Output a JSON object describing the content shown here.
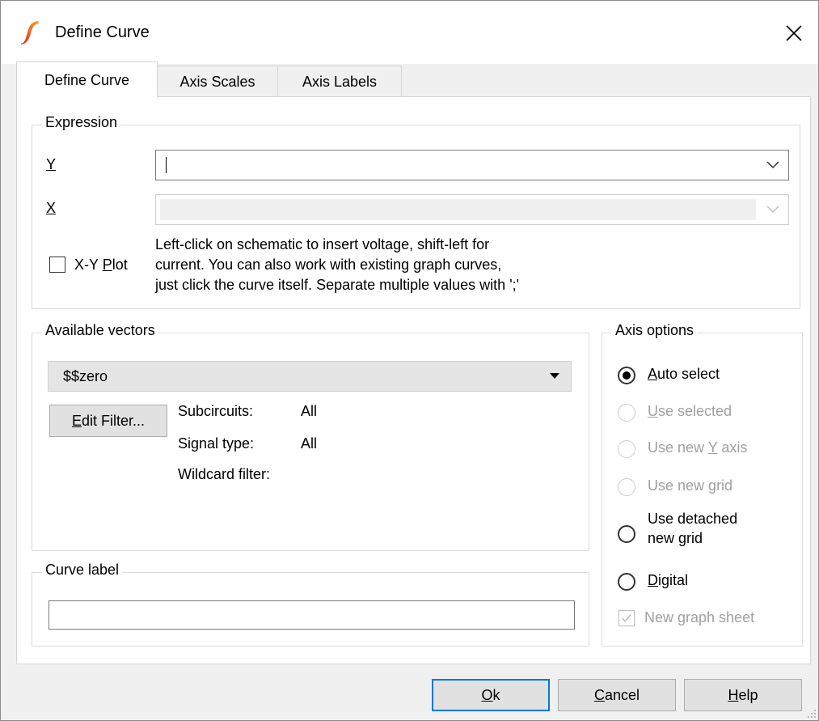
{
  "window": {
    "title": "Define Curve"
  },
  "tabs": [
    {
      "label": "Define Curve"
    },
    {
      "label": "Axis Scales"
    },
    {
      "label": "Axis Labels"
    }
  ],
  "expression": {
    "legend": "Expression",
    "y_label": "Y",
    "y_value": "",
    "x_label": "X",
    "x_value": "",
    "xy_plot_label": "X-Y ",
    "xy_plot_underlined": "P",
    "xy_plot_rest": "lot",
    "hint_line1": "Left-click on schematic to insert voltage, shift-left for",
    "hint_line2": "current. You can also work with existing graph curves,",
    "hint_line3": "just click the curve itself. Separate multiple values with ';'"
  },
  "vectors": {
    "legend": "Available vectors",
    "selected": "$$zero",
    "edit_filter_u": "E",
    "edit_filter_rest": "dit Filter...",
    "subcircuits_label": "Subcircuits:",
    "subcircuits_value": "All",
    "signal_type_label": "Signal type:",
    "signal_type_value": "All",
    "wildcard_label": "Wildcard filter:"
  },
  "curve_label": {
    "legend": "Curve label",
    "value": ""
  },
  "axis_options": {
    "legend": "Axis options",
    "auto_u": "A",
    "auto_rest": "uto select",
    "use_selected_u": "U",
    "use_selected_rest": "se selected",
    "use_new_y_pre": "Use new ",
    "use_new_y_u": "Y",
    "use_new_y_post": " axis",
    "use_new_grid_pre": "Use new ",
    "use_new_grid_u": "g",
    "use_new_grid_post": "rid",
    "detached_line1": "Use detached",
    "detached_line2": "new grid",
    "digital_u": "D",
    "digital_rest": "igital",
    "new_sheet": "New graph sheet"
  },
  "buttons": {
    "ok_u": "O",
    "ok_rest": "k",
    "cancel_u": "C",
    "cancel_rest": "ancel",
    "help_u": "H",
    "help_rest": "elp"
  },
  "colors": {
    "accent": "#0078d7",
    "icon_red": "#e8202a",
    "icon_orange": "#f5a623"
  }
}
